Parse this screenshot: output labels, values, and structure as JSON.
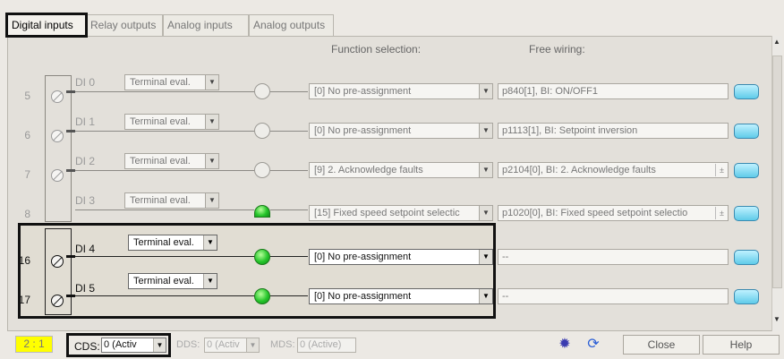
{
  "tabs": [
    {
      "label": "Digital inputs"
    },
    {
      "label": "Relay outputs"
    },
    {
      "label": "Analog inputs"
    },
    {
      "label": "Analog outputs"
    }
  ],
  "columns": {
    "function": "Function selection:",
    "wiring": "Free wiring:"
  },
  "rows": [
    {
      "num": "5",
      "name": "DI 0",
      "eval": "Terminal eval.",
      "function": "[0] No pre-assignment",
      "wiring": "p840[1], BI: ON/OFF1",
      "lamp": "off"
    },
    {
      "num": "6",
      "name": "DI 1",
      "eval": "Terminal eval.",
      "function": "[0] No pre-assignment",
      "wiring": "p1113[1], BI: Setpoint inversion",
      "lamp": "off"
    },
    {
      "num": "7",
      "name": "DI 2",
      "eval": "Terminal eval.",
      "function": "[9] 2. Acknowledge faults",
      "wiring": "p2104[0], BI: 2. Acknowledge faults",
      "lamp": "off"
    },
    {
      "num": "8",
      "name": "DI 3",
      "eval": "Terminal eval.",
      "function": "[15] Fixed speed setpoint selectic",
      "wiring": "p1020[0], BI: Fixed speed setpoint selectio",
      "lamp": "on"
    },
    {
      "num": "16",
      "name": "DI 4",
      "eval": "Terminal eval.",
      "function": "[0] No pre-assignment",
      "wiring": "--",
      "lamp": "on"
    },
    {
      "num": "17",
      "name": "DI 5",
      "eval": "Terminal eval.",
      "function": "[0] No pre-assignment",
      "wiring": "--",
      "lamp": "on"
    }
  ],
  "bottom": {
    "status": "2 : 1",
    "cds_label": "CDS:",
    "cds_value": "0 (Activ",
    "dds_label": "DDS:",
    "dds_value": "0 (Activ",
    "mds_label": "MDS:",
    "mds_value": "0 (Active)",
    "close": "Close",
    "help": "Help"
  },
  "colors": {
    "status_badge": "#ffff00",
    "lamp_on": "#25c52a",
    "link_button": "#5fcbe9"
  },
  "icons": [
    "gear-icon",
    "refresh-icon",
    "chevron-down-icon",
    "scroll-up-icon",
    "scroll-down-icon"
  ]
}
